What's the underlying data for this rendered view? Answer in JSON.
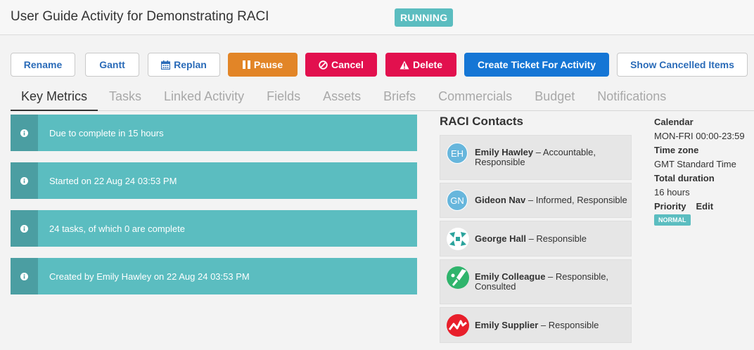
{
  "header": {
    "title": "User Guide Activity for Demonstrating RACI",
    "status": "RUNNING"
  },
  "toolbar": {
    "rename": "Rename",
    "gantt": "Gantt",
    "replan": "Replan",
    "pause": "Pause",
    "cancel": "Cancel",
    "delete": "Delete",
    "create_ticket": "Create Ticket For Activity",
    "show_cancelled": "Show Cancelled Items"
  },
  "tabs": [
    "Key Metrics",
    "Tasks",
    "Linked Activity",
    "Fields",
    "Assets",
    "Briefs",
    "Commercials",
    "Budget",
    "Notifications"
  ],
  "metrics": [
    "Due to complete in 15 hours",
    "Started on 22 Aug 24 03:53 PM",
    "24 tasks, of which 0 are complete",
    "Created by Emily Hawley on 22 Aug 24 03:53 PM"
  ],
  "raci": {
    "title": "RACI Contacts",
    "contacts": [
      {
        "initials": "EH",
        "name": "Emily Hawley",
        "roles": " – Accountable, Responsible"
      },
      {
        "initials": "GN",
        "name": "Gideon Nav",
        "roles": " – Informed, Responsible"
      },
      {
        "name": "George Hall",
        "roles": " – Responsible"
      },
      {
        "name": "Emily Colleague",
        "roles": " – Responsible, Consulted"
      },
      {
        "name": "Emily Supplier",
        "roles": " – Responsible"
      }
    ]
  },
  "details": {
    "calendar_label": "Calendar",
    "calendar_value": "MON-FRI 00:00-23:59",
    "timezone_label": "Time zone",
    "timezone_value": "GMT Standard Time",
    "duration_label": "Total duration",
    "duration_value": "16 hours",
    "priority_label": "Priority",
    "edit_label": "Edit",
    "priority_value": "NORMAL"
  },
  "colors": {
    "teal": "#5bbdc0",
    "teal_dark": "#4b9ea2",
    "orange": "#e28527",
    "red": "#e2104e",
    "blue": "#1576d5",
    "link": "#2a6bb8"
  }
}
